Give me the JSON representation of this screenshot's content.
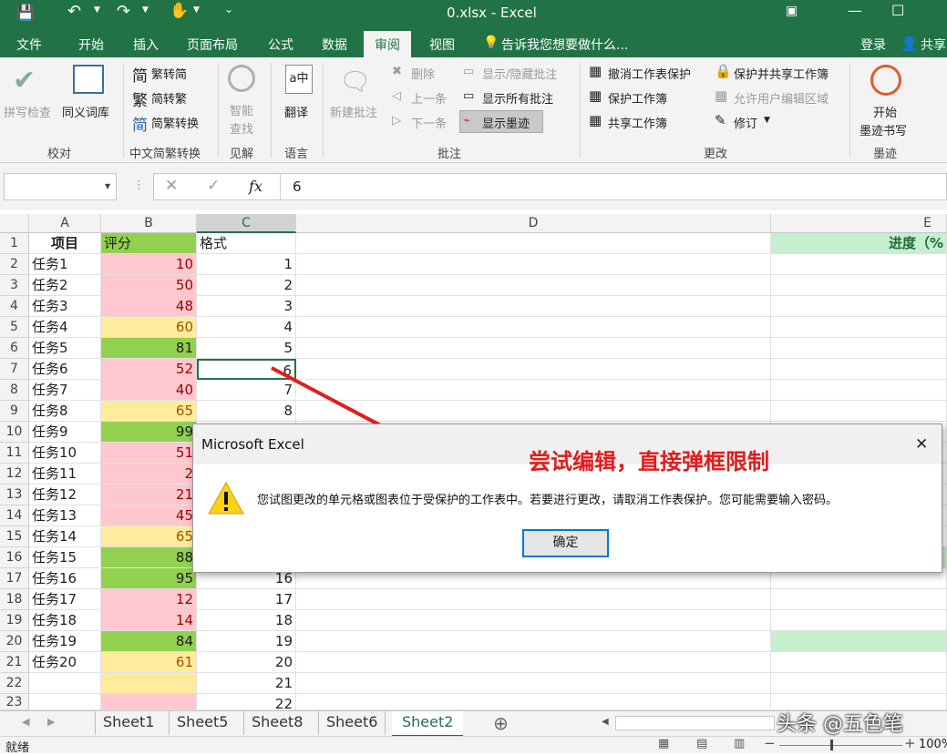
{
  "window": {
    "title": "0.xlsx - Excel"
  },
  "tabs": [
    "文件",
    "开始",
    "插入",
    "页面布局",
    "公式",
    "数据",
    "审阅",
    "视图"
  ],
  "active_tab": "审阅",
  "tell_me": "告诉我您想要做什么...",
  "login": "登录",
  "share": "共享",
  "ribbon": {
    "proofing": {
      "spell": "拼写检查",
      "thesaurus": "同义词库",
      "label": "校对"
    },
    "chinese": {
      "t2s": "繁转简",
      "s2t": "简转繁",
      "convert": "简繁转换",
      "label": "中文简繁转换"
    },
    "insights": {
      "smart": "智能",
      "lookup": "查找",
      "label": "见解"
    },
    "language": {
      "translate": "翻译",
      "label": "语言"
    },
    "comments": {
      "new": "新建批注",
      "delete": "删除",
      "prev": "上一条",
      "next": "下一条",
      "show_hide": "显示/隐藏批注",
      "show_all": "显示所有批注",
      "show_ink": "显示墨迹",
      "label": "批注"
    },
    "changes": {
      "unprotect_sheet": "撤消工作表保护",
      "protect_wb": "保护工作簿",
      "share_wb": "共享工作簿",
      "protect_share": "保护并共享工作簿",
      "allow_edit": "允许用户编辑区域",
      "track": "修订",
      "label": "更改"
    },
    "ink": {
      "start": "开始",
      "ink_write": "墨迹书写",
      "label": "墨迹"
    }
  },
  "formula": {
    "value": "6",
    "fx": "fx"
  },
  "columns": [
    "A",
    "B",
    "C",
    "D",
    "E"
  ],
  "header_row": {
    "a": "项目",
    "b": "评分",
    "c": "格式",
    "e": "进度（%"
  },
  "rows": [
    {
      "n": "2",
      "a": "任务1",
      "b": "10",
      "c": "1",
      "color": "red"
    },
    {
      "n": "3",
      "a": "任务2",
      "b": "50",
      "c": "2",
      "color": "red"
    },
    {
      "n": "4",
      "a": "任务3",
      "b": "48",
      "c": "3",
      "color": "red"
    },
    {
      "n": "5",
      "a": "任务4",
      "b": "60",
      "c": "4",
      "color": "yellow"
    },
    {
      "n": "6",
      "a": "任务5",
      "b": "81",
      "c": "5",
      "color": "green"
    },
    {
      "n": "7",
      "a": "任务6",
      "b": "52",
      "c": "6",
      "color": "red"
    },
    {
      "n": "8",
      "a": "任务7",
      "b": "40",
      "c": "7",
      "color": "red"
    },
    {
      "n": "9",
      "a": "任务8",
      "b": "65",
      "c": "8",
      "color": "yellow"
    },
    {
      "n": "10",
      "a": "任务9",
      "b": "99",
      "c": "",
      "color": "green"
    },
    {
      "n": "11",
      "a": "任务10",
      "b": "51",
      "c": "",
      "color": "red"
    },
    {
      "n": "12",
      "a": "任务11",
      "b": "2",
      "c": "",
      "color": "red"
    },
    {
      "n": "13",
      "a": "任务12",
      "b": "21",
      "c": "",
      "color": "red"
    },
    {
      "n": "14",
      "a": "任务13",
      "b": "45",
      "c": "",
      "color": "red"
    },
    {
      "n": "15",
      "a": "任务14",
      "b": "65",
      "c": "",
      "color": "yellow"
    },
    {
      "n": "16",
      "a": "任务15",
      "b": "88",
      "c": "",
      "color": "green"
    },
    {
      "n": "17",
      "a": "任务16",
      "b": "95",
      "c": "16",
      "color": "green"
    },
    {
      "n": "18",
      "a": "任务17",
      "b": "12",
      "c": "17",
      "color": "red"
    },
    {
      "n": "19",
      "a": "任务18",
      "b": "14",
      "c": "18",
      "color": "red"
    },
    {
      "n": "20",
      "a": "任务19",
      "b": "84",
      "c": "19",
      "color": "green"
    },
    {
      "n": "21",
      "a": "任务20",
      "b": "61",
      "c": "20",
      "color": "yellow"
    },
    {
      "n": "22",
      "a": "",
      "b": "",
      "c": "21",
      "color": "yellow"
    },
    {
      "n": "23",
      "a": "",
      "b": "",
      "c": "22",
      "color": "red"
    }
  ],
  "first_row_num": "1",
  "sheets": [
    "Sheet1",
    "Sheet5",
    "Sheet8",
    "Sheet6",
    "Sheet2"
  ],
  "active_sheet": "Sheet2",
  "status": {
    "ready": "就绪",
    "zoom": "100%"
  },
  "dialog": {
    "title": "Microsoft Excel",
    "message": "您试图更改的单元格或图表位于受保护的工作表中。若要进行更改，请取消工作表保护。您可能需要输入密码。",
    "ok": "确定",
    "close": "✕"
  },
  "annotation": "尝试编辑，直接弹框限制",
  "watermark": "头条 @五色笔",
  "colors": {
    "excel_green": "#217346",
    "cell_red_bg": "#ffc7ce",
    "cell_red_fg": "#9c0006",
    "cell_yellow_bg": "#ffeb9c",
    "cell_yellow_fg": "#9c5700",
    "cell_green_bg": "#92d050",
    "cell_green_fg": "#1b1b1b",
    "e_green_bg": "#c6efce",
    "arrow": "#e21c1c"
  }
}
